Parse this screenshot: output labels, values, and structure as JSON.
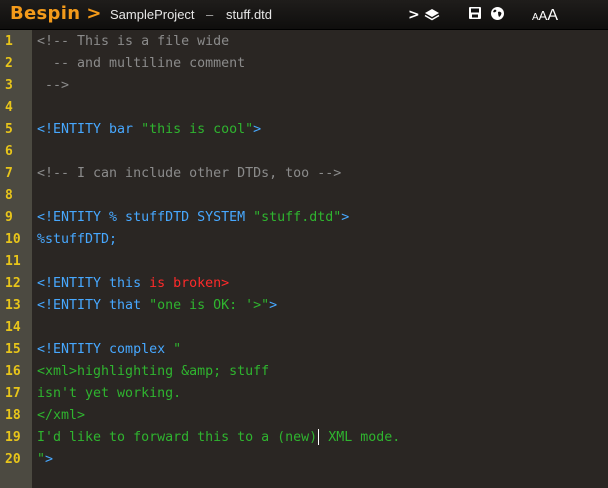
{
  "header": {
    "logo": "Bespin",
    "logo_arrow": ">",
    "project": "SampleProject",
    "separator": "–",
    "file": "stuff.dtd",
    "icons": {
      "command": "command-line-icon",
      "layers": "layers-icon",
      "save": "save-icon",
      "globe": "globe-icon",
      "font": "font-size-icon"
    },
    "font_size_labels": [
      "A",
      "A",
      "A"
    ]
  },
  "editor": {
    "line_numbers": [
      "1",
      "2",
      "3",
      "4",
      "5",
      "6",
      "7",
      "8",
      "9",
      "10",
      "11",
      "12",
      "13",
      "14",
      "15",
      "16",
      "17",
      "18",
      "19",
      "20"
    ],
    "lines": [
      [
        {
          "t": "comment",
          "v": "<!-- This is a file wide"
        }
      ],
      [
        {
          "t": "comment",
          "v": "  -- and multiline comment"
        }
      ],
      [
        {
          "t": "comment",
          "v": " -->"
        }
      ],
      [],
      [
        {
          "t": "tag",
          "v": "<!ENTITY bar "
        },
        {
          "t": "string",
          "v": "\"this is cool\""
        },
        {
          "t": "tag",
          "v": ">"
        }
      ],
      [],
      [
        {
          "t": "comment",
          "v": "<!-- I can include other DTDs, too -->"
        }
      ],
      [],
      [
        {
          "t": "tag",
          "v": "<!ENTITY % stuffDTD SYSTEM "
        },
        {
          "t": "string",
          "v": "\"stuff.dtd\""
        },
        {
          "t": "tag",
          "v": ">"
        }
      ],
      [
        {
          "t": "tag",
          "v": "%stuffDTD;"
        }
      ],
      [],
      [
        {
          "t": "tag",
          "v": "<!ENTITY this "
        },
        {
          "t": "error",
          "v": "is broken>"
        }
      ],
      [
        {
          "t": "tag",
          "v": "<!ENTITY that "
        },
        {
          "t": "string",
          "v": "\"one is OK: '>\""
        },
        {
          "t": "tag",
          "v": ">"
        }
      ],
      [],
      [
        {
          "t": "tag",
          "v": "<!ENTITY complex "
        },
        {
          "t": "string",
          "v": "\""
        }
      ],
      [
        {
          "t": "plain",
          "v": "<xml>highlighting &amp; stuff"
        }
      ],
      [
        {
          "t": "plain",
          "v": "isn't yet working."
        }
      ],
      [
        {
          "t": "plain",
          "v": "</xml>"
        }
      ],
      [
        {
          "t": "plain",
          "v": "I'd like to forward this to a (new)"
        },
        {
          "t": "caret",
          "v": ""
        },
        {
          "t": "plain",
          "v": " XML mode."
        }
      ],
      [
        {
          "t": "string",
          "v": "\""
        },
        {
          "t": "tag",
          "v": ">"
        }
      ]
    ]
  }
}
